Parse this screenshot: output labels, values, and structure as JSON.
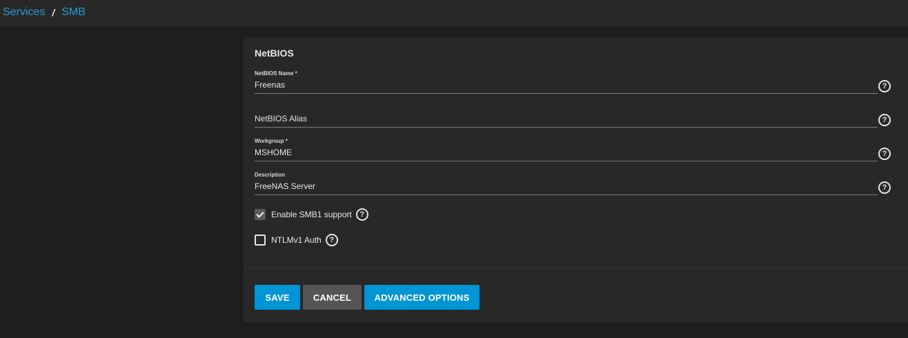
{
  "breadcrumb": {
    "items": [
      "Services",
      "SMB"
    ],
    "separator": "/"
  },
  "form": {
    "section_title": "NetBIOS",
    "fields": [
      {
        "label": "NetBIOS Name *",
        "value": "Freenas",
        "help_icon": "help-circle-icon"
      },
      {
        "label": "",
        "placeholder": "NetBIOS Alias",
        "value": "",
        "help_icon": "help-circle-icon"
      },
      {
        "label": "Workgroup *",
        "value": "MSHOME",
        "help_icon": "help-circle-icon"
      },
      {
        "label": "Description",
        "value": "FreeNAS Server",
        "help_icon": "help-circle-icon"
      }
    ],
    "checkboxes": [
      {
        "label": "Enable SMB1 support",
        "checked": true
      },
      {
        "label": "NTLMv1 Auth",
        "checked": false
      }
    ]
  },
  "actions": {
    "save_label": "SAVE",
    "cancel_label": "CANCEL",
    "advanced_label": "ADVANCED OPTIONS"
  },
  "colors": {
    "accent": "#0095d5",
    "link": "#2b9bd8",
    "background": "#1e1e1e",
    "card": "#282828"
  }
}
